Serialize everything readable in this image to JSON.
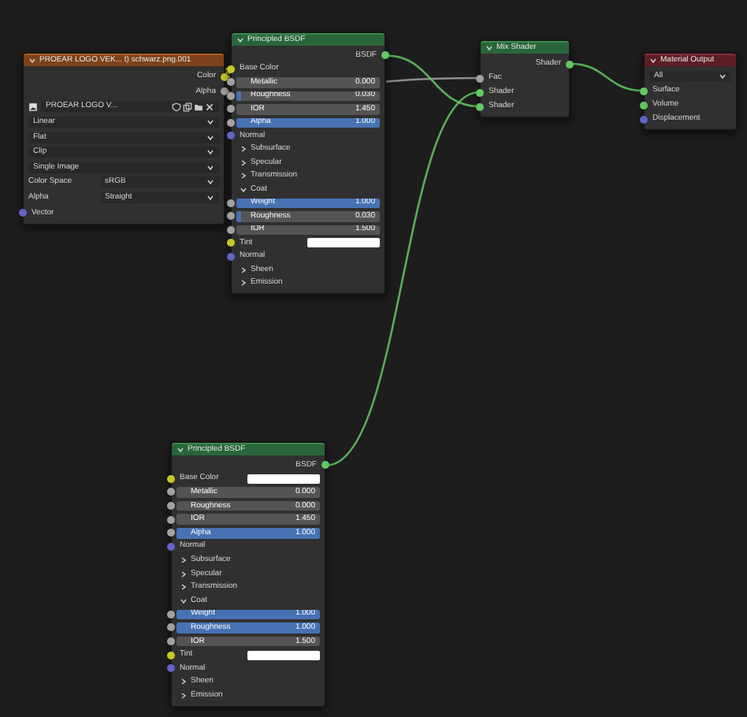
{
  "nodes": [
    {
      "title": "PROEAR LOGO VEK... t) schwarz.png.001",
      "kind": "image_texture",
      "rows": [
        {
          "kind": "output",
          "label": "Color",
          "color": "#c7c729"
        },
        {
          "kind": "output",
          "label": "Alpha",
          "color": "#a1a1a1"
        },
        {
          "kind": "image",
          "value": "PROEAR LOGO V..."
        },
        {
          "kind": "dropdown",
          "value": "Linear"
        },
        {
          "kind": "dropdown",
          "value": "Flat"
        },
        {
          "kind": "dropdown",
          "value": "Clip"
        },
        {
          "kind": "dropdown",
          "value": "Single Image"
        },
        {
          "kind": "prop",
          "label": "Color Space",
          "value": "sRGB"
        },
        {
          "kind": "prop",
          "label": "Alpha",
          "value": "Straight"
        },
        {
          "kind": "input",
          "label": "Vector",
          "color": "#6363c7"
        }
      ]
    },
    {
      "title": "Principled BSDF",
      "kind": "shader",
      "rows": [
        {
          "kind": "output",
          "label": "BSDF",
          "color": "#63c763"
        },
        {
          "kind": "input",
          "label": "Base Color",
          "color": "#c7c729"
        },
        {
          "kind": "slider",
          "label": "Metallic",
          "value": "0.000",
          "level": 0,
          "color": "#a1a1a1"
        },
        {
          "kind": "slider",
          "label": "Roughness",
          "value": "0.030",
          "level": 0.03,
          "color": "#a1a1a1"
        },
        {
          "kind": "slider",
          "label": "IOR",
          "value": "1.450",
          "level": 0,
          "color": "#a1a1a1"
        },
        {
          "kind": "slider",
          "label": "Alpha",
          "value": "1.000",
          "level": 1,
          "color": "#a1a1a1"
        },
        {
          "kind": "input",
          "label": "Normal",
          "color": "#6363c7"
        },
        {
          "kind": "panel",
          "label": "Subsurface",
          "expanded": false
        },
        {
          "kind": "panel",
          "label": "Specular",
          "expanded": false
        },
        {
          "kind": "panel",
          "label": "Transmission",
          "expanded": false
        },
        {
          "kind": "panel",
          "label": "Coat",
          "expanded": true
        },
        {
          "kind": "slider",
          "label": "Weight",
          "value": "1.000",
          "level": 1,
          "color": "#a1a1a1"
        },
        {
          "kind": "slider",
          "label": "Roughness",
          "value": "0.030",
          "level": 0.03,
          "color": "#a1a1a1"
        },
        {
          "kind": "slider",
          "label": "IOR",
          "value": "1.500",
          "level": 0,
          "color": "#a1a1a1"
        },
        {
          "kind": "color_field",
          "label": "Tint",
          "color": "#c7c729"
        },
        {
          "kind": "input",
          "label": "Normal",
          "color": "#6363c7"
        },
        {
          "kind": "panel",
          "label": "Sheen",
          "expanded": false
        },
        {
          "kind": "panel",
          "label": "Emission",
          "expanded": false
        }
      ]
    },
    {
      "title": "Mix Shader",
      "kind": "shader",
      "rows": [
        {
          "kind": "output",
          "label": "Shader",
          "color": "#63c763"
        },
        {
          "kind": "input",
          "label": "Fac",
          "color": "#a1a1a1"
        },
        {
          "kind": "input",
          "label": "Shader",
          "color": "#63c763"
        },
        {
          "kind": "input",
          "label": "Shader",
          "color": "#63c763"
        }
      ]
    },
    {
      "title": "Material Output",
      "kind": "output",
      "rows": [
        {
          "kind": "dropdown",
          "value": "All"
        },
        {
          "kind": "input",
          "label": "Surface",
          "color": "#63c763"
        },
        {
          "kind": "input",
          "label": "Volume",
          "color": "#63c763"
        },
        {
          "kind": "input",
          "label": "Displacement",
          "color": "#6363c7"
        }
      ]
    },
    {
      "title": "Principled BSDF",
      "kind": "shader",
      "rows": [
        {
          "kind": "output",
          "label": "BSDF",
          "color": "#63c763"
        },
        {
          "kind": "color_field",
          "label": "Base Color",
          "color": "#c7c729"
        },
        {
          "kind": "slider",
          "label": "Metallic",
          "value": "0.000",
          "level": 0,
          "color": "#a1a1a1"
        },
        {
          "kind": "slider",
          "label": "Roughness",
          "value": "0.000",
          "level": 0,
          "color": "#a1a1a1"
        },
        {
          "kind": "slider",
          "label": "IOR",
          "value": "1.450",
          "level": 0,
          "color": "#a1a1a1"
        },
        {
          "kind": "slider",
          "label": "Alpha",
          "value": "1.000",
          "level": 1,
          "color": "#a1a1a1"
        },
        {
          "kind": "input",
          "label": "Normal",
          "color": "#6363c7"
        },
        {
          "kind": "panel",
          "label": "Subsurface",
          "expanded": false
        },
        {
          "kind": "panel",
          "label": "Specular",
          "expanded": false
        },
        {
          "kind": "panel",
          "label": "Transmission",
          "expanded": false
        },
        {
          "kind": "panel",
          "label": "Coat",
          "expanded": true
        },
        {
          "kind": "slider",
          "label": "Weight",
          "value": "1.000",
          "level": 1,
          "color": "#a1a1a1"
        },
        {
          "kind": "slider",
          "label": "Roughness",
          "value": "1.000",
          "level": 1,
          "color": "#a1a1a1"
        },
        {
          "kind": "slider",
          "label": "IOR",
          "value": "1.500",
          "level": 0,
          "color": "#a1a1a1"
        },
        {
          "kind": "color_field",
          "label": "Tint",
          "color": "#c7c729"
        },
        {
          "kind": "input",
          "label": "Normal",
          "color": "#6363c7"
        },
        {
          "kind": "panel",
          "label": "Sheen",
          "expanded": false
        },
        {
          "kind": "panel",
          "label": "Emission",
          "expanded": false
        }
      ]
    }
  ]
}
